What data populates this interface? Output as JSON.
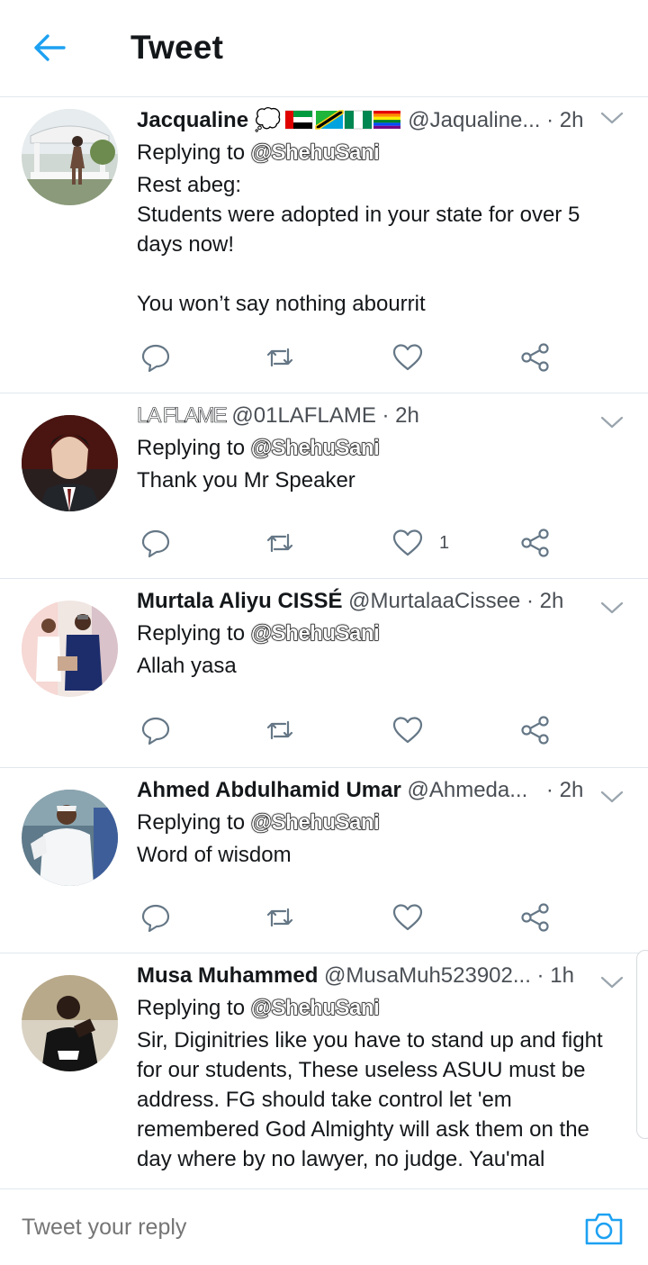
{
  "header": {
    "title": "Tweet"
  },
  "tweets": [
    {
      "name": "Jacqualine 💭",
      "handle": "@Jaqualine...",
      "sep": "·",
      "time": "2h",
      "replying_prefix": "Replying to",
      "replying_to": "@ShehuSani",
      "text": "Rest abeg:\nStudents were adopted in your state for over 5 days now!\n\nYou won’t say nothing abourrit",
      "likes": ""
    },
    {
      "name": "LA FLAME",
      "handle": "@01LAFLAME",
      "sep": "·",
      "time": "2h",
      "replying_prefix": "Replying to",
      "replying_to": "@ShehuSani",
      "text": "Thank you Mr Speaker",
      "likes": "1"
    },
    {
      "name": "Murtala Aliyu CISSÉ",
      "handle": "@MurtalaaCissee",
      "sep": "·",
      "time": "2h",
      "replying_prefix": "Replying to",
      "replying_to": "@ShehuSani",
      "text": "Allah yasa",
      "likes": ""
    },
    {
      "name": "Ahmed Abdulhamid Umar",
      "handle": "@Ahmeda...",
      "sep": "·",
      "time": "2h",
      "replying_prefix": "Replying to",
      "replying_to": "@ShehuSani",
      "text": "Word of wisdom",
      "likes": ""
    },
    {
      "name": "Musa Muhammed",
      "handle": "@MusaMuh523902...",
      "sep": "·",
      "time": "1h",
      "replying_prefix": "Replying to",
      "replying_to": "@ShehuSani",
      "text": "Sir, Diginitries like you have to stand up and fight for our students, These useless ASUU must be address. FG should take control let 'em remembered God Almighty will ask them on the day where by no lawyer, no judge. Yau'mal",
      "likes": ""
    }
  ],
  "reply_bar": {
    "placeholder": "Tweet your reply"
  },
  "colors": {
    "accent": "#1da1f2",
    "icon": "#657786",
    "divider": "#e1e8ed"
  },
  "icons": [
    "back-arrow-icon",
    "chevron-down-icon",
    "reply-icon",
    "retweet-icon",
    "like-icon",
    "share-icon",
    "camera-icon"
  ]
}
